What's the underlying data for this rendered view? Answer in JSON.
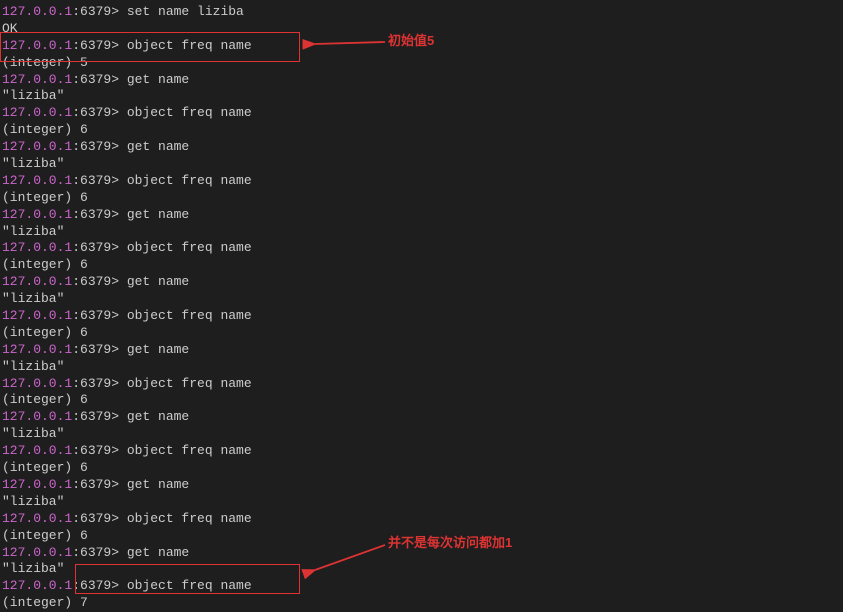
{
  "prompt": {
    "ip": "127.0.0.1",
    "port": ":6379> "
  },
  "lines": [
    {
      "type": "cmd",
      "text": "set name liziba"
    },
    {
      "type": "out",
      "text": "OK"
    },
    {
      "type": "cmd",
      "text": "object freq name"
    },
    {
      "type": "out",
      "text": "(integer) 5"
    },
    {
      "type": "cmd",
      "text": "get name"
    },
    {
      "type": "out",
      "text": "\"liziba\""
    },
    {
      "type": "cmd",
      "text": "object freq name"
    },
    {
      "type": "out",
      "text": "(integer) 6"
    },
    {
      "type": "cmd",
      "text": "get name"
    },
    {
      "type": "out",
      "text": "\"liziba\""
    },
    {
      "type": "cmd",
      "text": "object freq name"
    },
    {
      "type": "out",
      "text": "(integer) 6"
    },
    {
      "type": "cmd",
      "text": "get name"
    },
    {
      "type": "out",
      "text": "\"liziba\""
    },
    {
      "type": "cmd",
      "text": "object freq name"
    },
    {
      "type": "out",
      "text": "(integer) 6"
    },
    {
      "type": "cmd",
      "text": "get name"
    },
    {
      "type": "out",
      "text": "\"liziba\""
    },
    {
      "type": "cmd",
      "text": "object freq name"
    },
    {
      "type": "out",
      "text": "(integer) 6"
    },
    {
      "type": "cmd",
      "text": "get name"
    },
    {
      "type": "out",
      "text": "\"liziba\""
    },
    {
      "type": "cmd",
      "text": "object freq name"
    },
    {
      "type": "out",
      "text": "(integer) 6"
    },
    {
      "type": "cmd",
      "text": "get name"
    },
    {
      "type": "out",
      "text": "\"liziba\""
    },
    {
      "type": "cmd",
      "text": "object freq name"
    },
    {
      "type": "out",
      "text": "(integer) 6"
    },
    {
      "type": "cmd",
      "text": "get name"
    },
    {
      "type": "out",
      "text": "\"liziba\""
    },
    {
      "type": "cmd",
      "text": "object freq name"
    },
    {
      "type": "out",
      "text": "(integer) 6"
    },
    {
      "type": "cmd",
      "text": "get name"
    },
    {
      "type": "out",
      "text": "\"liziba\""
    },
    {
      "type": "cmd",
      "text": "object freq name"
    },
    {
      "type": "out",
      "text": "(integer) 7"
    }
  ],
  "annotations": {
    "anno1": "初始值5",
    "anno2": "并不是每次访问都加1"
  }
}
